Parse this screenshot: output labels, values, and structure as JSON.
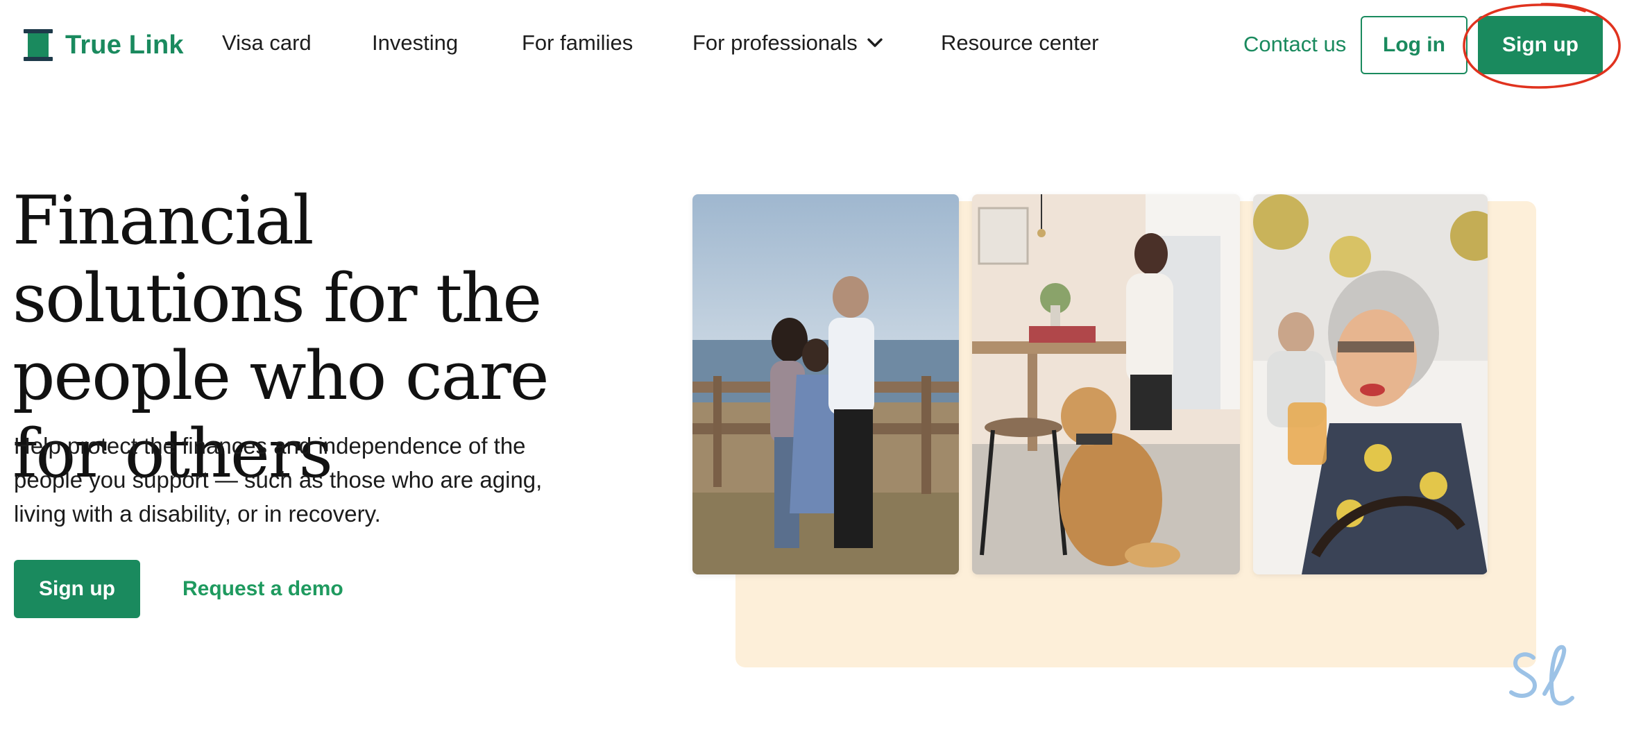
{
  "brand": {
    "name": "True Link",
    "color": "#1a8a5e"
  },
  "nav": {
    "links": [
      {
        "label": "Visa card"
      },
      {
        "label": "Investing"
      },
      {
        "label": "For families"
      },
      {
        "label": "For professionals",
        "icon": "chevron-down-icon"
      },
      {
        "label": "Resource center"
      }
    ],
    "contact_label": "Contact us",
    "login_label": "Log in",
    "signup_label": "Sign up"
  },
  "hero": {
    "title": "Financial solutions for the people who care for others",
    "subtitle": "Help protect the finances and independence of the people you support — such as those who are aging, living with a disability, or in recovery.",
    "primary_cta": "Sign up",
    "secondary_cta": "Request a demo"
  },
  "colors": {
    "accent": "#1a8a5e",
    "cream": "#fdefd9",
    "annotation_red": "#e0321e",
    "watermark_blue": "#9cc2e6"
  },
  "icons": {
    "logo": "spool-logo-icon",
    "chevron": "chevron-down-icon",
    "watermark": "sl-watermark-icon"
  }
}
